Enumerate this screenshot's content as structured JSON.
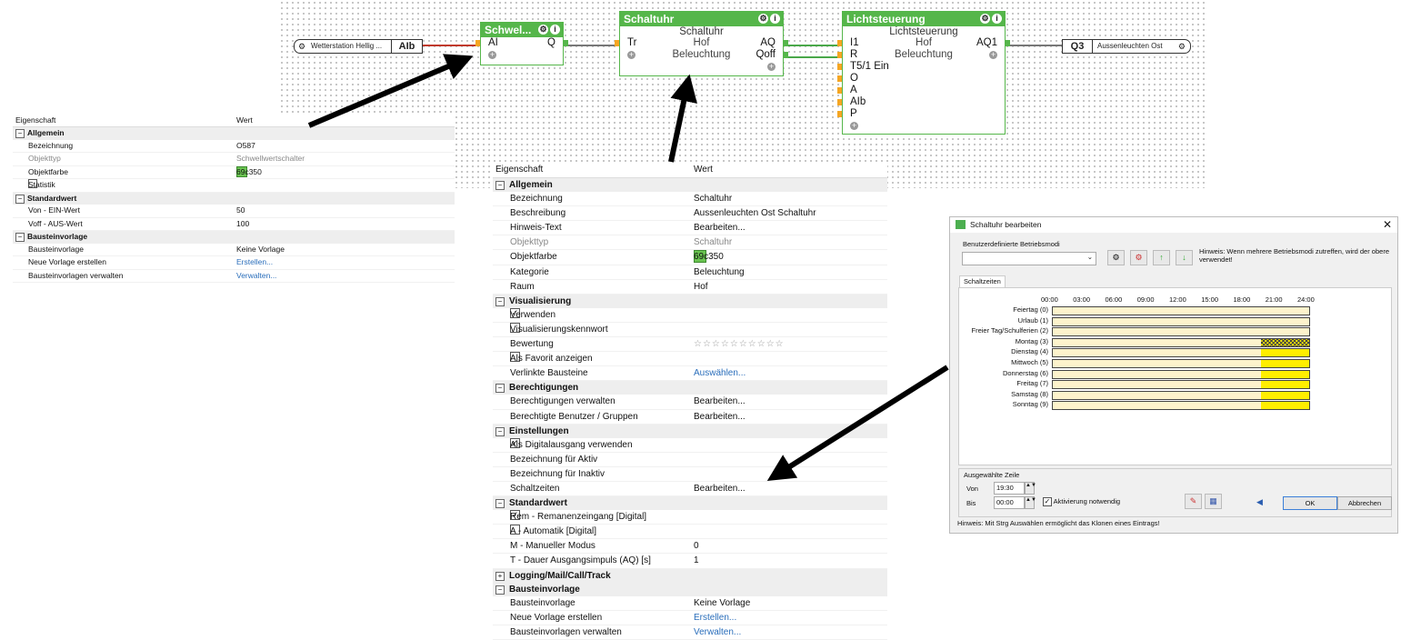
{
  "canvas": {
    "input_label": "Wetterstation Hellig ...",
    "input_tag": "AIb",
    "output_tag": "Q3",
    "output_label": "Aussenleuchten Ost"
  },
  "blocks": {
    "schwell": {
      "title": "Schwel...",
      "in": "AI",
      "out": "Q"
    },
    "schaltuhr": {
      "title": "Schaltuhr",
      "subtitle": "Schaltuhr",
      "in1": "Tr",
      "mid1": "Hof",
      "out1": "AQ",
      "mid2": "Beleuchtung",
      "out2": "Qoff"
    },
    "licht": {
      "title": "Lichtsteuerung",
      "subtitle": "Lichtsteuerung",
      "inputs": [
        "I1",
        "R",
        "T5/1 Ein",
        "O",
        "A",
        "AIb",
        "P"
      ],
      "mid1": "Hof",
      "mid2": "Beleuchtung",
      "out1": "AQ1"
    }
  },
  "colors": {
    "accent": "#69c350",
    "block": "#55b64a",
    "pin_in": "#f5a623",
    "active": "#ffee00",
    "inactive": "#fdf3cc"
  },
  "left_props": {
    "header": [
      "Eigenschaft",
      "Wert"
    ],
    "sections": {
      "allgemein": "Allgemein",
      "standardwert": "Standardwert",
      "bausteinvorlage": "Bausteinvorlage"
    },
    "rows": {
      "bezeichnung": [
        "Bezeichnung",
        "O587"
      ],
      "objekttyp": [
        "Objekttyp",
        "Schwellwertschalter"
      ],
      "objektfarbe": [
        "Objektfarbe",
        "69c350"
      ],
      "statistik": [
        "Statistik",
        ""
      ],
      "von": [
        "Von - EIN-Wert",
        "50"
      ],
      "voff": [
        "Voff - AUS-Wert",
        "100"
      ],
      "vorlage": [
        "Bausteinvorlage",
        "Keine Vorlage"
      ],
      "neu": [
        "Neue Vorlage erstellen",
        "Erstellen..."
      ],
      "verwalten": [
        "Bausteinvorlagen verwalten",
        "Verwalten..."
      ]
    }
  },
  "main_props": {
    "header": [
      "Eigenschaft",
      "Wert"
    ],
    "sections": {
      "allgemein": "Allgemein",
      "visualisierung": "Visualisierung",
      "berechtigungen": "Berechtigungen",
      "einstellungen": "Einstellungen",
      "standardwert": "Standardwert",
      "logging": "Logging/Mail/Call/Track",
      "bausteinvorlage": "Bausteinvorlage"
    },
    "rows": {
      "bezeichnung": [
        "Bezeichnung",
        "Schaltuhr"
      ],
      "beschreibung": [
        "Beschreibung",
        "Aussenleuchten Ost Schaltuhr"
      ],
      "hinweis": [
        "Hinweis-Text",
        "Bearbeiten..."
      ],
      "objekttyp": [
        "Objekttyp",
        "Schaltuhr"
      ],
      "objektfarbe": [
        "Objektfarbe",
        "69c350"
      ],
      "kategorie": [
        "Kategorie",
        "Beleuchtung"
      ],
      "raum": [
        "Raum",
        "Hof"
      ],
      "verwenden": [
        "Verwenden",
        ""
      ],
      "viskennwort": [
        "Visualisierungskennwort",
        ""
      ],
      "bewertung": [
        "Bewertung",
        "☆☆☆☆☆☆☆☆☆☆"
      ],
      "favorit": [
        "Als Favorit anzeigen",
        ""
      ],
      "verlinkt": [
        "Verlinkte Bausteine",
        "Auswählen..."
      ],
      "ber_verwalten": [
        "Berechtigungen verwalten",
        "Bearbeiten..."
      ],
      "ber_benutzer": [
        "Berechtigte Benutzer / Gruppen",
        "Bearbeiten..."
      ],
      "digital": [
        "Als Digitalausgang verwenden",
        ""
      ],
      "aktiv": [
        "Bezeichnung für Aktiv",
        ""
      ],
      "inaktiv": [
        "Bezeichnung für Inaktiv",
        ""
      ],
      "schaltzeiten": [
        "Schaltzeiten",
        "Bearbeiten..."
      ],
      "rem": [
        "Rem - Remanenzeingang [Digital]",
        ""
      ],
      "auto": [
        "A - Automatik [Digital]",
        ""
      ],
      "manuell": [
        "M - Manueller Modus",
        "0"
      ],
      "dauer": [
        "T - Dauer Ausgangsimpuls (AQ) [s]",
        "1"
      ],
      "vorlage": [
        "Bausteinvorlage",
        "Keine Vorlage"
      ],
      "neu": [
        "Neue Vorlage erstellen",
        "Erstellen..."
      ],
      "verwalten": [
        "Bausteinvorlagen verwalten",
        "Verwalten..."
      ]
    }
  },
  "dialog": {
    "title": "Schaltuhr bearbeiten",
    "modes_label": "Benutzerdefinierte Betriebsmodi",
    "hint": "Hinweis: Wenn mehrere Betriebsmodi zutreffen, wird der obere verwendet!",
    "tab": "Schaltzeiten",
    "hours": [
      "00:00",
      "03:00",
      "06:00",
      "09:00",
      "12:00",
      "15:00",
      "18:00",
      "21:00",
      "24:00"
    ],
    "days": [
      "Feiertag (0)",
      "Urlaub (1)",
      "Freier Tag/Schulferien (2)",
      "Montag (3)",
      "Dienstag (4)",
      "Mittwoch (5)",
      "Donnerstag (6)",
      "Freitag (7)",
      "Samstag (8)",
      "Sonntag (9)"
    ],
    "schedule": [
      null,
      null,
      null,
      [
        19.5,
        24
      ],
      [
        19.5,
        24
      ],
      [
        19.5,
        24
      ],
      [
        19.5,
        24
      ],
      [
        19.5,
        24
      ],
      [
        19.5,
        24
      ],
      [
        19.5,
        24
      ]
    ],
    "selected_row": 3,
    "sel_label": "Ausgewählte Zeile",
    "von_label": "Von",
    "von_value": "19:30",
    "bis_label": "Bis",
    "bis_value": "00:00",
    "aktivierung": "Aktivierung notwendig",
    "ok": "OK",
    "cancel": "Abbrechen",
    "footer": "Hinweis: Mit Strg Auswählen ermöglicht das Klonen eines Eintrags!"
  }
}
